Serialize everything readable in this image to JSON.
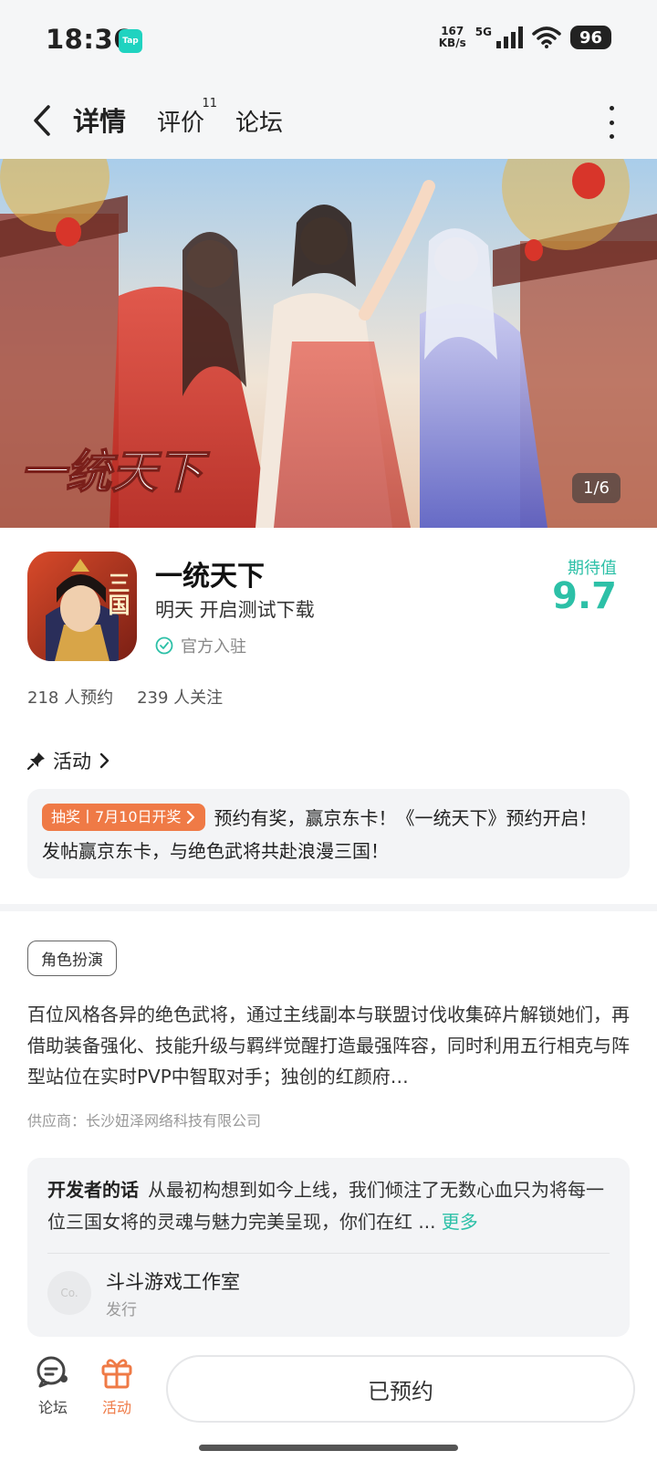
{
  "status_bar": {
    "time": "18:36",
    "app_badge": "Tap",
    "net_speed_value": "167",
    "net_speed_unit": "KB/s",
    "network": "5G",
    "battery": "96"
  },
  "header": {
    "tabs": [
      {
        "label": "详情",
        "active": true
      },
      {
        "label": "评价",
        "badge": "11"
      },
      {
        "label": "论坛"
      }
    ]
  },
  "banner": {
    "logo_text": "一统天下",
    "counter": "1/6"
  },
  "game": {
    "icon_text": "三国",
    "title": "一统天下",
    "subtitle": "明天 开启测试下载",
    "official": "官方入驻",
    "expect_label": "期待值",
    "expect_value": "9.7",
    "reservations": "218 人预约",
    "followers": "239 人关注"
  },
  "activity": {
    "heading": "活动",
    "tag": "抽奖丨7月10日开奖",
    "text": "预约有奖，赢京东卡！《一统天下》预约开启！发帖赢京东卡，与绝色武将共赴浪漫三国！"
  },
  "details": {
    "genre": "角色扮演",
    "description": "百位风格各异的绝色武将，通过主线副本与联盟讨伐收集碎片解锁她们，再借助装备强化、技能升级与羁绊觉醒打造最强阵容，同时利用五行相克与阵型站位在实时PVP中智取对手；独创的红颜府…",
    "supplier": "供应商：长沙妞泽网络科技有限公司"
  },
  "developer": {
    "label": "开发者的话",
    "text": "从最初构想到如今上线，我们倾注了无数心血只为将每一位三国女将的灵魂与魅力完美呈现，你们在红 ...",
    "more": "更多",
    "avatar_text": "Co.",
    "name": "斗斗游戏工作室",
    "role": "发行"
  },
  "bottom_bar": {
    "forum_label": "论坛",
    "activity_label": "活动",
    "reserved_label": "已预约"
  },
  "colors": {
    "accent": "#2cc0a7",
    "orange": "#ef7a46"
  }
}
